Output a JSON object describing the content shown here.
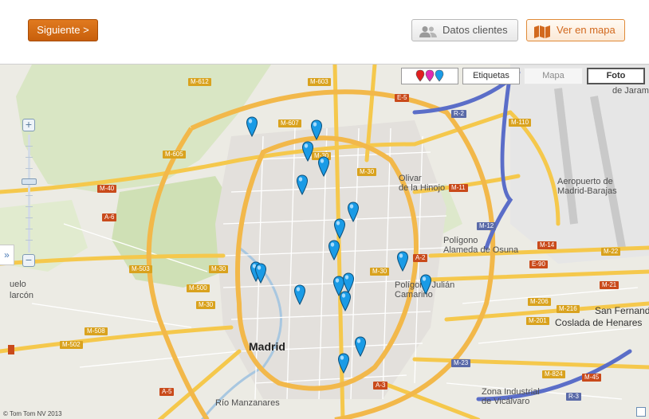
{
  "toolbar": {
    "next_label": "Siguiente >",
    "clients_label": "Datos clientes",
    "map_label": "Ver en mapa"
  },
  "map_controls": {
    "labels_label": "Etiquetas",
    "map_label": "Mapa",
    "photo_label": "Foto",
    "active_view": "Foto",
    "expander_label": "»"
  },
  "map": {
    "copyright": "© Tom Tom NV 2013",
    "marker_color": "#1a9be6",
    "labels": {
      "madrid": "Madrid",
      "olivar": "Olivar",
      "hinojo": "de la Hinojo",
      "aeropuerto": "Aeropuerto de",
      "barajas": "Madrid-Barajas",
      "poligono_alameda": "Polígono",
      "alameda": "Alameda de Osuna",
      "poligono_julian": "Polígono Julián",
      "camarino": "Camarino",
      "san_fernando": "San Fernando",
      "coslada": "Coslada de Henares",
      "zona_industrial": "Zona Industrial",
      "vicalvaro": "de Vicálvaro",
      "rio": "Río Manzanares",
      "jarama": "de Jarama",
      "pozuelo": "uelo",
      "alarcon": "larcón"
    },
    "roads": [
      "M-612",
      "M-603",
      "M-607",
      "M-605",
      "M-30",
      "M-40",
      "A-6",
      "M-503",
      "M-500",
      "M-30",
      "M-508",
      "M-502",
      "A-5",
      "M-30",
      "E-5",
      "R-2",
      "M-110",
      "M-11",
      "M-12",
      "M-14",
      "M-22",
      "A-2",
      "E-90",
      "M-21",
      "M-206",
      "M-216",
      "M-201",
      "M-23",
      "M-45",
      "M-824",
      "R-3",
      "A-3",
      "M-30",
      "M-30"
    ]
  }
}
